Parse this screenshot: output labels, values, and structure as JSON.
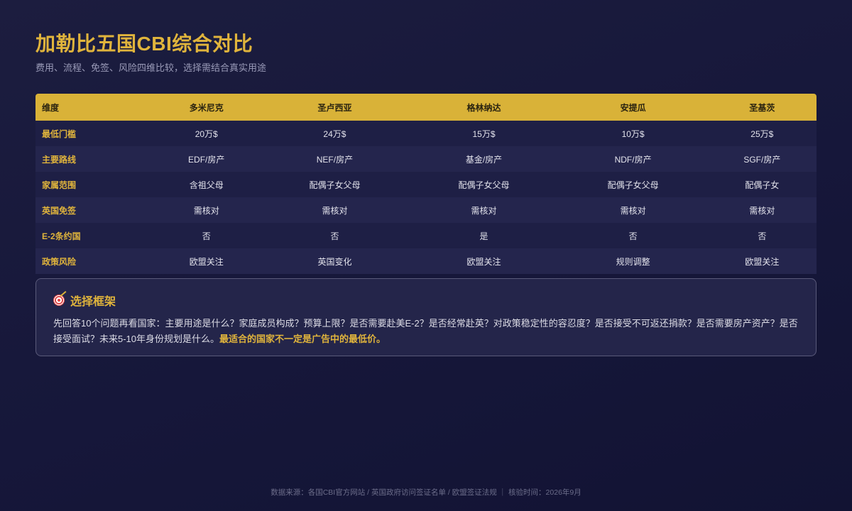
{
  "page": {
    "title": "加勒比五国CBI综合对比",
    "subtitle": "费用、流程、免签、风险四维比较，选择需结合真实用途"
  },
  "table": {
    "headers": [
      "维度",
      "多米尼克",
      "圣卢西亚",
      "格林纳达",
      "安提瓜",
      "圣基茨"
    ],
    "rows": [
      [
        "最低门槛",
        "20万$",
        "24万$",
        "15万$",
        "10万$",
        "25万$"
      ],
      [
        "主要路线",
        "EDF/房产",
        "NEF/房产",
        "基金/房产",
        "NDF/房产",
        "SGF/房产"
      ],
      [
        "家属范围",
        "含祖父母",
        "配偶子女父母",
        "配偶子女父母",
        "配偶子女父母",
        "配偶子女"
      ],
      [
        "英国免签",
        "需核对",
        "需核对",
        "需核对",
        "需核对",
        "需核对"
      ],
      [
        "E-2条约国",
        "否",
        "否",
        "是",
        "否",
        "否"
      ],
      [
        "政策风险",
        "欧盟关注",
        "英国变化",
        "欧盟关注",
        "规则调整",
        "欧盟关注"
      ]
    ]
  },
  "callout": {
    "icon": "target-icon",
    "title": "选择框架",
    "body": "先回答10个问题再看国家：主要用途是什么？家庭成员构成？预算上限？是否需要赴美E-2？是否经常赴英？对政策稳定性的容忍度？是否接受不可返还捐款？是否需要房产资产？是否接受面试？未来5-10年身份规划是什么。",
    "highlight": "最适合的国家不一定是广告中的最低价。"
  },
  "footer": {
    "text": "数据来源：各国CBI官方网站 / 英国政府访问签证名单 / 欧盟签证法规 ｜ 核验时间：2026年9月"
  },
  "colors": {
    "accent": "#e0b43c",
    "header_bg": "#d9b238",
    "background": "#1c1d3f"
  }
}
